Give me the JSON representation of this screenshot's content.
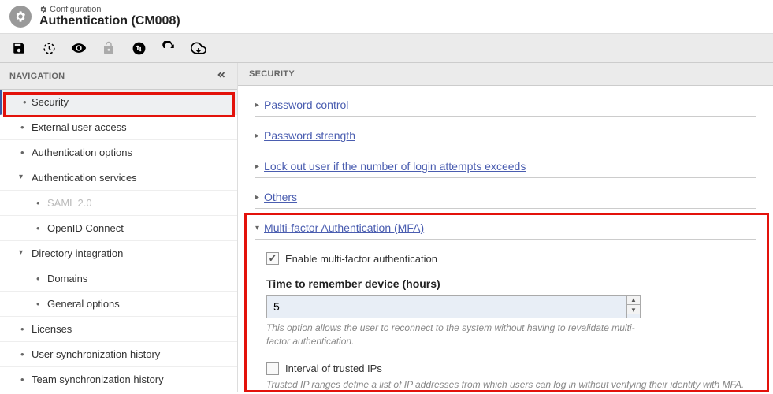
{
  "header": {
    "config_label": "Configuration",
    "title": "Authentication (CM008)"
  },
  "sidebar": {
    "title": "NAVIGATION",
    "items": [
      {
        "label": "Security"
      },
      {
        "label": "External user access"
      },
      {
        "label": "Authentication options"
      },
      {
        "label": "Authentication services"
      },
      {
        "label": "SAML 2.0"
      },
      {
        "label": "OpenID Connect"
      },
      {
        "label": "Directory integration"
      },
      {
        "label": "Domains"
      },
      {
        "label": "General options"
      },
      {
        "label": "Licenses"
      },
      {
        "label": "User synchronization history"
      },
      {
        "label": "Team synchronization history"
      }
    ]
  },
  "content": {
    "title": "SECURITY",
    "sections": [
      {
        "label": "Password control"
      },
      {
        "label": "Password strength"
      },
      {
        "label": "Lock out user if the number of login attempts exceeds"
      },
      {
        "label": "Others"
      },
      {
        "label": "Multi-factor Authentication (MFA)"
      }
    ],
    "mfa": {
      "enable_label": "Enable multi-factor authentication",
      "time_label": "Time to remember device (hours)",
      "time_value": "5",
      "time_help": "This option allows the user to reconnect to the system without having to revalidate multi-factor authentication.",
      "trusted_ip_label": "Interval of trusted IPs",
      "trusted_ip_help": "Trusted IP ranges define a list of IP addresses from which users can log in without verifying their identity with MFA."
    }
  }
}
